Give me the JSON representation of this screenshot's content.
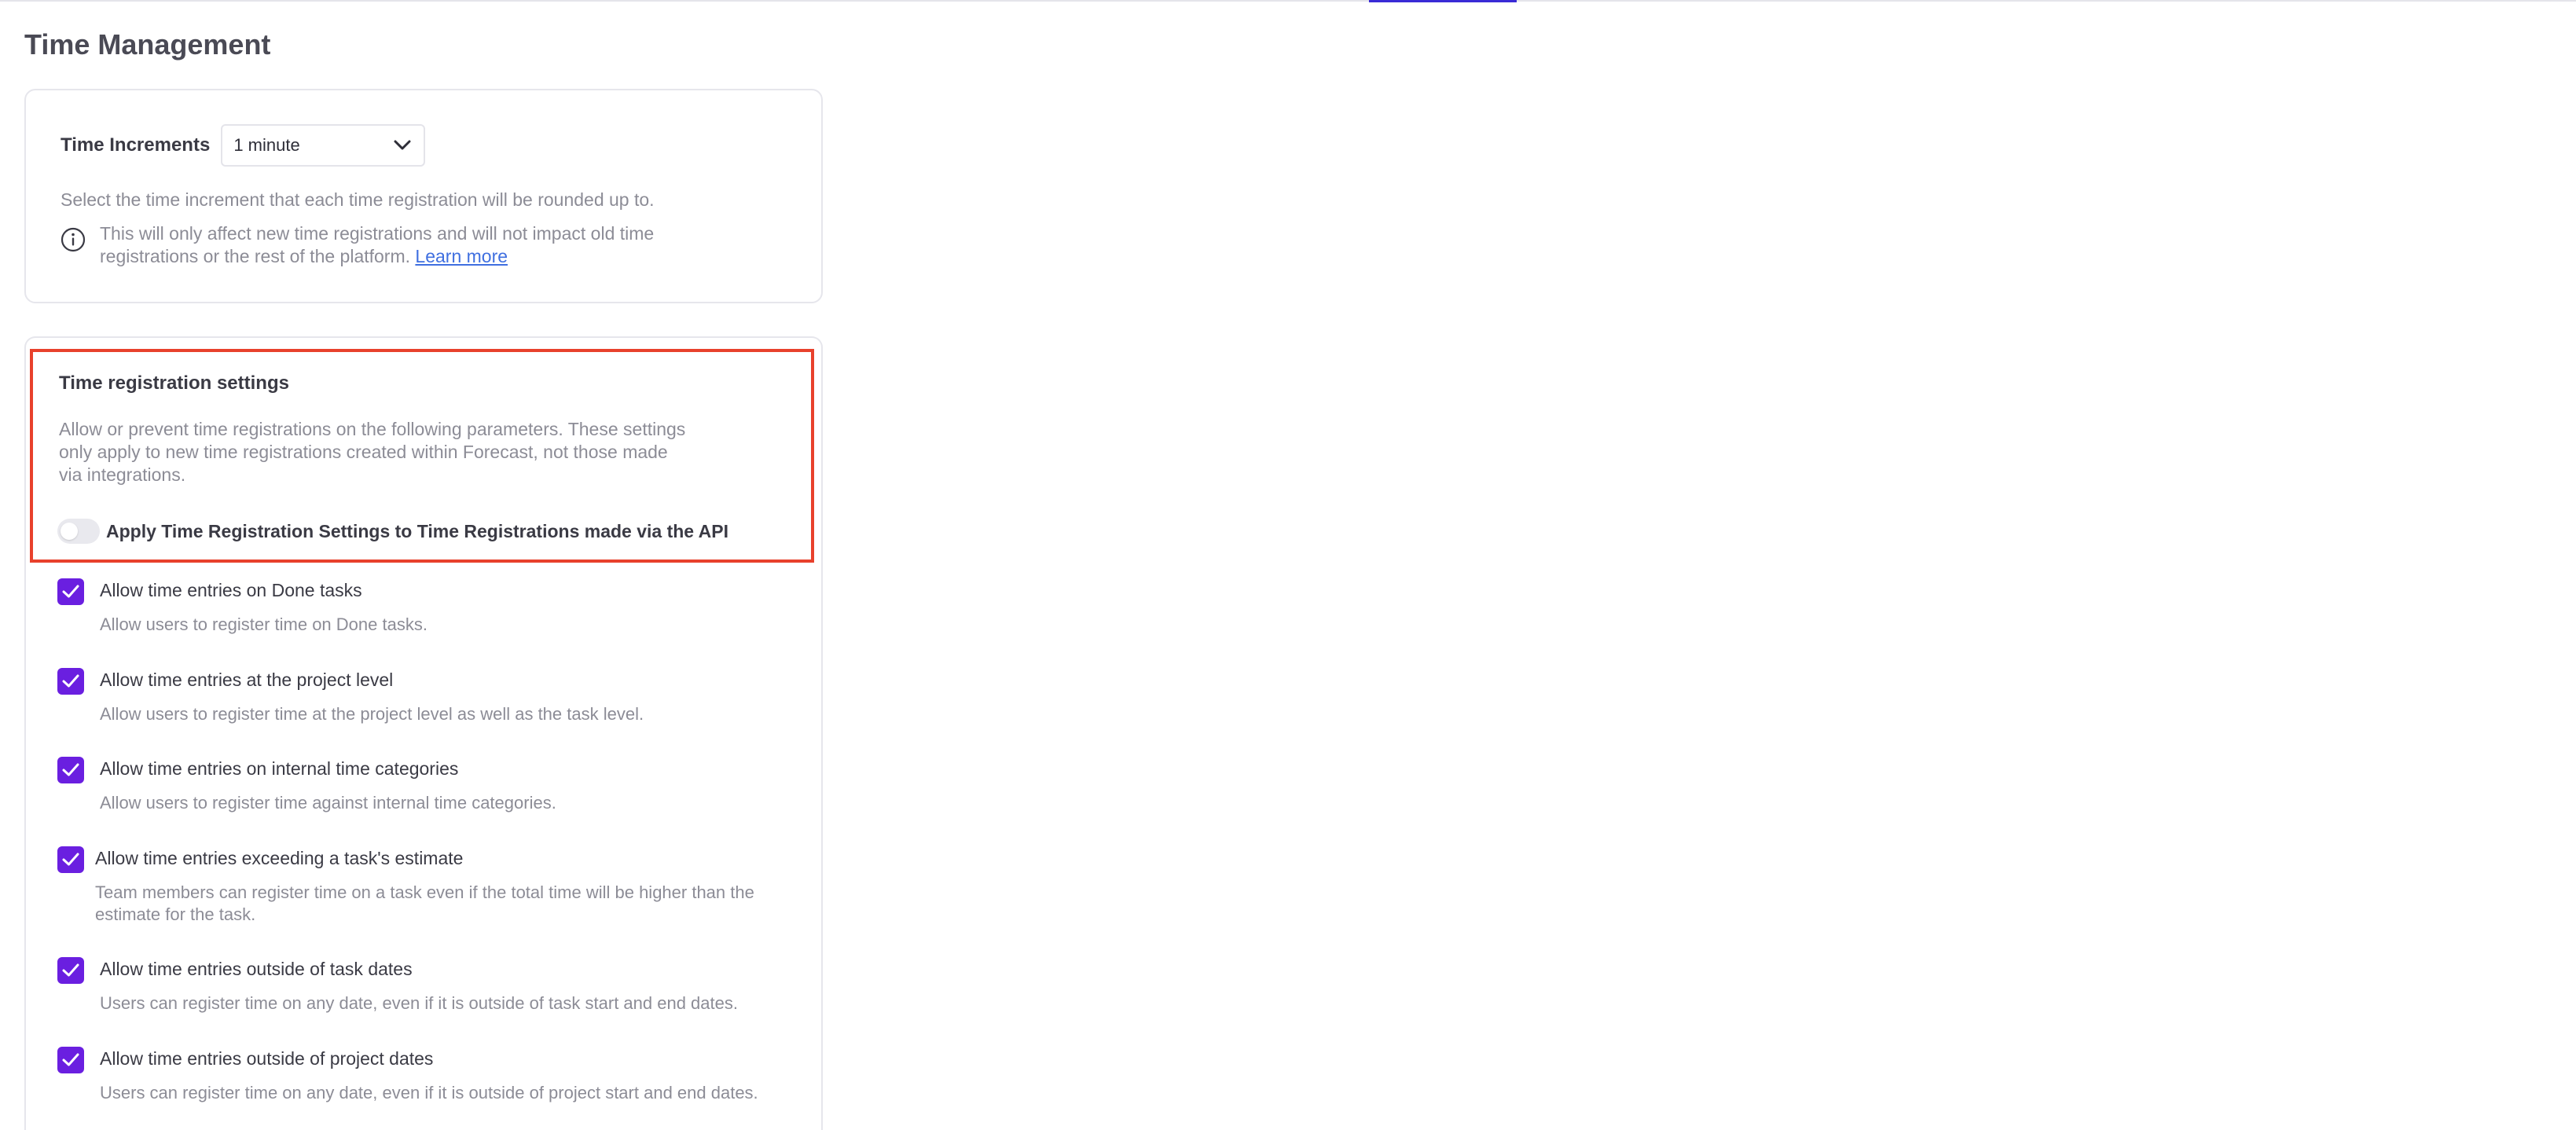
{
  "page": {
    "title": "Time Management"
  },
  "time_increments": {
    "label": "Time Increments",
    "selected": "1 minute",
    "description": "Select the time increment that each time registration will be rounded up to.",
    "info_text": "This will only affect new time registrations and will not impact old time registrations or the rest of the platform.",
    "learn_more": "Learn more",
    "icons": {
      "dropdown": "chevron-down-icon",
      "info": "info-circle-icon"
    }
  },
  "registration_settings": {
    "title": "Time registration settings",
    "description": "Allow or prevent time registrations on the following parameters. These settings only apply to new time registrations created within Forecast, not those made via integrations.",
    "api_toggle": {
      "label": "Apply Time Registration Settings to Time Registrations made via the API",
      "enabled": false
    },
    "options": [
      {
        "title": "Allow time entries on Done tasks",
        "description": "Allow users to register time on Done tasks.",
        "checked": true
      },
      {
        "title": "Allow time entries at the project level",
        "description": "Allow users to register time at the project level as well as the task level.",
        "checked": true
      },
      {
        "title": "Allow time entries on internal time categories",
        "description": "Allow users to register time against internal time categories.",
        "checked": true
      },
      {
        "title": "Allow time entries exceeding a task's estimate",
        "description": "Team members can register time on a task even if the total time will be higher than the estimate for the task.",
        "checked": true
      },
      {
        "title": "Allow time entries outside of task dates",
        "description": "Users can register time on any date, even if it is outside of task start and end dates.",
        "checked": true
      },
      {
        "title": "Allow time entries outside of project dates",
        "description": "Users can register time on any date, even if it is outside of project start and end dates.",
        "checked": true
      }
    ]
  },
  "colors": {
    "accent_purple": "#6a1fe0",
    "highlight_red": "#e8412c",
    "link_blue": "#3f6fe0",
    "top_accent": "#3a2bd6"
  }
}
